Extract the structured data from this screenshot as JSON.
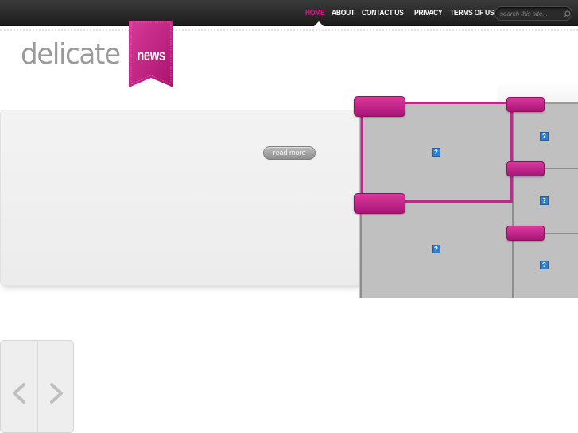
{
  "nav": {
    "items": [
      {
        "label": "Home",
        "active": true
      },
      {
        "label": "About",
        "active": false
      },
      {
        "label": "Contact Us",
        "active": false
      },
      {
        "label": "Privacy",
        "active": false
      },
      {
        "label": "Terms of Use",
        "active": false
      }
    ],
    "search_placeholder": "search this site..."
  },
  "logo": {
    "word": "delicate",
    "ribbon_text": "news"
  },
  "slider": {
    "read_more_label": "read more"
  },
  "thumbnails": {
    "placeholder_glyph": "?"
  },
  "colors": {
    "accent": "#d11a8a",
    "topbar": "#2a2a2a",
    "ribbon": "#c41e86",
    "tab": "#c0287f",
    "thumb_bg": "#c0c0c0"
  },
  "icons": {
    "search": "search-icon",
    "prev": "chevron-left-icon",
    "next": "chevron-right-icon",
    "broken_image": "broken-image-icon"
  }
}
